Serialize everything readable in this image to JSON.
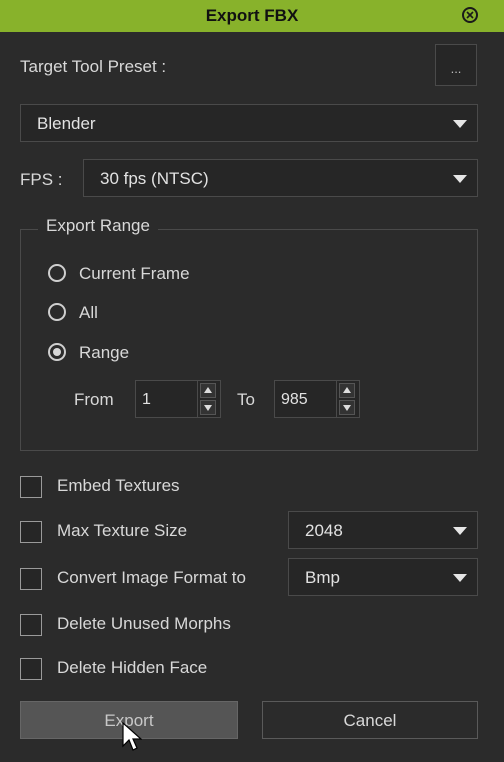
{
  "window": {
    "title": "Export FBX"
  },
  "preset": {
    "label": "Target Tool Preset :",
    "more_button": "...",
    "selected": "Blender"
  },
  "fps": {
    "label": "FPS :",
    "selected": "30 fps (NTSC)"
  },
  "export_range": {
    "legend": "Export Range",
    "options": [
      {
        "label": "Current Frame",
        "selected": false
      },
      {
        "label": "All",
        "selected": false
      },
      {
        "label": "Range",
        "selected": true
      }
    ],
    "from_label": "From",
    "from_value": "1",
    "to_label": "To",
    "to_value": "985"
  },
  "options": {
    "embed_textures": {
      "label": "Embed Textures",
      "checked": false
    },
    "max_texture_size": {
      "label": "Max Texture Size",
      "checked": false,
      "value": "2048"
    },
    "convert_image_format": {
      "label": "Convert Image Format to",
      "checked": false,
      "value": "Bmp"
    },
    "delete_unused_morphs": {
      "label": "Delete Unused Morphs",
      "checked": false
    },
    "delete_hidden_face": {
      "label": "Delete Hidden Face",
      "checked": false
    }
  },
  "buttons": {
    "export": "Export",
    "cancel": "Cancel"
  },
  "colors": {
    "titlebar": "#88b22b",
    "background": "#2b2b2b"
  }
}
